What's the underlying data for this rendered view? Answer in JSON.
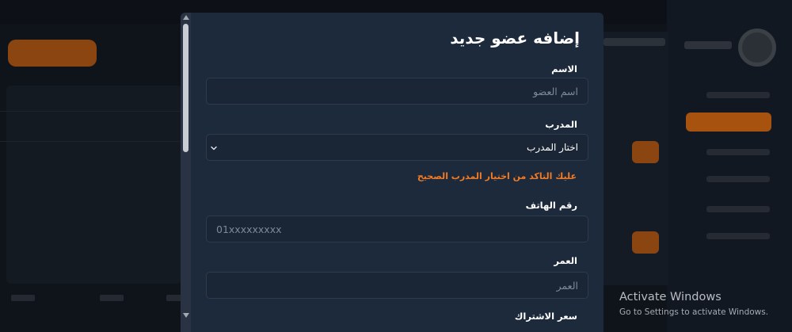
{
  "modal": {
    "title": "إضافه عضو جديد",
    "fields": {
      "name": {
        "label": "الاسم",
        "placeholder": "اسم العضو",
        "value": ""
      },
      "coach": {
        "label": "المدرب",
        "selected": "اختار المدرب",
        "error": "عليك التاكد من اختيار المدرب الصحيح"
      },
      "phone": {
        "label": "رقم الهاتف",
        "placeholder": "01xxxxxxxxx",
        "value": ""
      },
      "age": {
        "label": "العمر",
        "placeholder": "العمر",
        "value": ""
      },
      "price": {
        "label": "سعر الاشتراك"
      }
    }
  },
  "watermark": {
    "title": "Activate Windows",
    "subtitle": "Go to Settings to activate Windows."
  },
  "colors": {
    "modal_bg": "#1d2a3c",
    "input_bg": "#1a2536",
    "error": "#f27b24",
    "accent": "#a8520f"
  },
  "icons": {
    "select_chevron": "chevron-down-icon",
    "scroll_up": "arrow-up-icon",
    "scroll_down": "arrow-down-icon"
  }
}
